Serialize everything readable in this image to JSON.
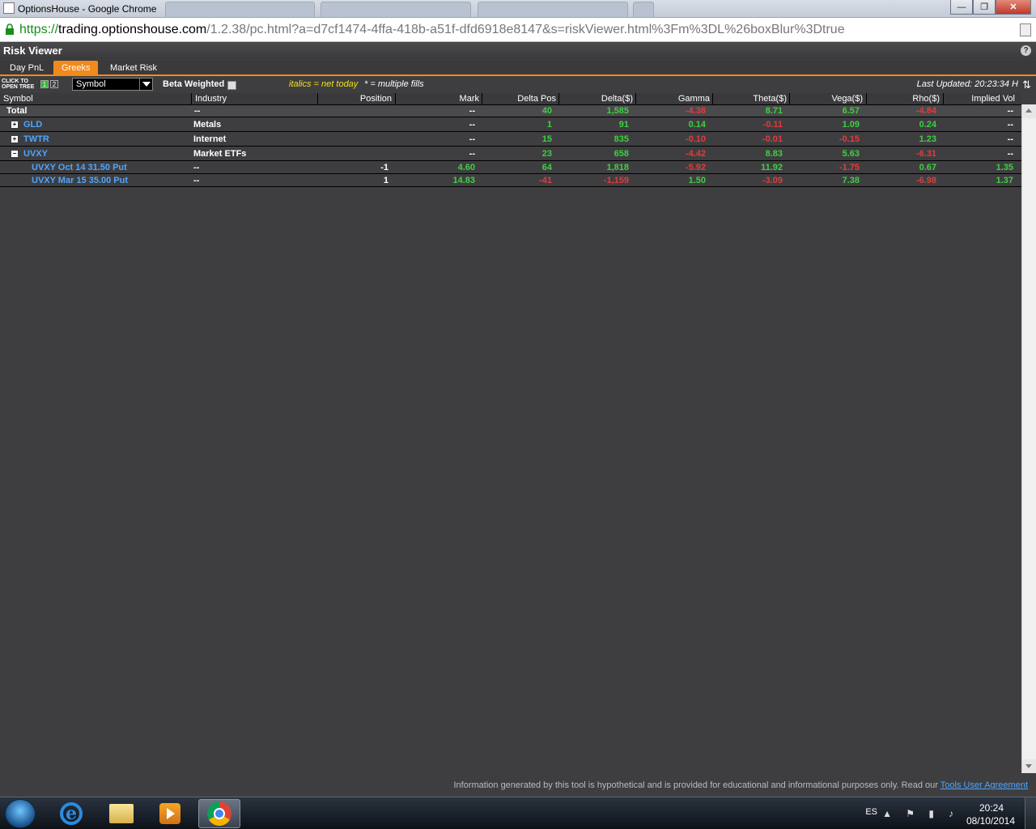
{
  "window": {
    "title": "OptionsHouse - Google Chrome",
    "controls": {
      "minimize": "—",
      "maximize": "❐",
      "close": "✕"
    }
  },
  "address": {
    "scheme": "https://",
    "host": "trading.optionshouse.com",
    "path": "/1.2.38/pc.html?a=d7cf1474-4ffa-418b-a51f-dfd6918e8147&s=riskViewer.html%3Fm%3DL%26boxBlur%3Dtrue"
  },
  "app": {
    "title": "Risk Viewer",
    "help": "?",
    "tabs": [
      {
        "label": "Day PnL"
      },
      {
        "label": "Greeks"
      },
      {
        "label": "Market Risk"
      }
    ],
    "toolbar": {
      "open_tree_line1": "CLICK TO",
      "open_tree_line2": "OPEN TREE",
      "tree_level_1": "1",
      "tree_level_2": "2",
      "group_by": "Symbol",
      "beta_weighted": "Beta Weighted",
      "legend_italics": "italics = net today",
      "legend_multi": "* = multiple fills",
      "last_updated": "Last Updated: 20:23:34 H",
      "refresh": "⇅"
    }
  },
  "grid": {
    "columns": [
      "Symbol",
      "Industry",
      "Position",
      "Mark",
      "Delta Pos",
      "Delta($)",
      "Gamma",
      "Theta($)",
      "Vega($)",
      "Rho($)",
      "Implied Vol"
    ],
    "total": {
      "symbol": "Total",
      "industry": "--",
      "position": "",
      "mark": "--",
      "delta_pos": "40",
      "delta_usd": "1,585",
      "gamma": "-4.38",
      "theta": "8.71",
      "vega": "6.57",
      "rho": "-4.84",
      "iv": "--"
    },
    "groups": [
      {
        "toggle": "+",
        "symbol": "GLD",
        "industry": "Metals",
        "position": "",
        "mark": "--",
        "delta_pos": "1",
        "delta_usd": "91",
        "gamma": "0.14",
        "theta": "-0.11",
        "vega": "1.09",
        "rho": "0.24",
        "iv": "--"
      },
      {
        "toggle": "+",
        "symbol": "TWTR",
        "industry": "Internet",
        "position": "",
        "mark": "--",
        "delta_pos": "15",
        "delta_usd": "835",
        "gamma": "-0.10",
        "theta": "-0.01",
        "vega": "-0.15",
        "rho": "1.23",
        "iv": "--"
      },
      {
        "toggle": "−",
        "symbol": "UVXY",
        "industry": "Market ETFs",
        "position": "",
        "mark": "--",
        "delta_pos": "23",
        "delta_usd": "658",
        "gamma": "-4.42",
        "theta": "8.83",
        "vega": "5.63",
        "rho": "-6.31",
        "iv": "--"
      }
    ],
    "children": [
      {
        "symbol": "UVXY Oct 14 31.50 Put",
        "industry": "--",
        "position": "-1",
        "mark": "4.60",
        "delta_pos": "64",
        "delta_usd": "1,818",
        "gamma": "-5.92",
        "theta": "11.92",
        "vega": "-1.75",
        "rho": "0.67",
        "iv": "1.35"
      },
      {
        "symbol": "UVXY Mar 15 35.00 Put",
        "industry": "--",
        "position": "1",
        "mark": "14.83",
        "delta_pos": "-41",
        "delta_usd": "-1,159",
        "gamma": "1.50",
        "theta": "-3.09",
        "vega": "7.38",
        "rho": "-6.98",
        "iv": "1.37"
      }
    ]
  },
  "footer": {
    "disclaimer": "Information generated by this tool is hypothetical and is provided for educational and informational purposes only. Read our ",
    "link": "Tools User Agreement"
  },
  "taskbar": {
    "lang": "ES",
    "time": "20:24",
    "date": "08/10/2014",
    "ie_glyph": "e"
  },
  "colors": {
    "accent": "#f08a1c",
    "positive": "#3fd03f",
    "negative": "#e23c3c",
    "link": "#4ea6ff"
  }
}
